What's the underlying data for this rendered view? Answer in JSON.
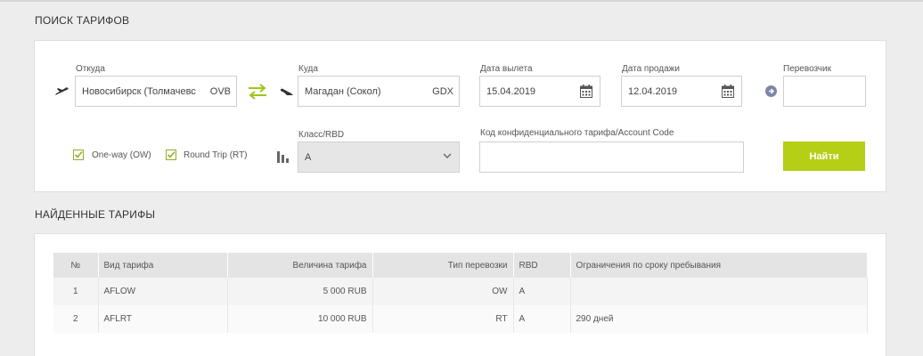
{
  "search": {
    "title": "ПОИСК ТАРИФОВ",
    "from_label": "Откуда",
    "from_value": "Новосибирск (Толмачевс",
    "from_code": "OVB",
    "to_label": "Куда",
    "to_value": "Магадан (Сокол)",
    "to_code": "GDX",
    "depart_label": "Дата вылета",
    "depart_value": "15.04.2019",
    "sale_label": "Дата продажи",
    "sale_value": "12.04.2019",
    "carrier_label": "Перевозчик",
    "carrier_value": "",
    "oneway_label": "One-way (OW)",
    "roundtrip_label": "Round Trip (RT)",
    "class_label": "Класс/RBD",
    "class_value": "A",
    "code_label": "Код конфиденциального тарифа/Account Code",
    "code_value": "",
    "find_button": "Найти"
  },
  "results": {
    "title": "НАЙДЕННЫЕ ТАРИФЫ",
    "headers": [
      "№",
      "Вид тарифа",
      "Величина тарифа",
      "Тип перевозки",
      "RBD",
      "Ограничения по сроку пребывания"
    ],
    "rows": [
      [
        "1",
        "AFLOW",
        "5 000  RUB",
        "OW",
        "A",
        ""
      ],
      [
        "2",
        "AFLRT",
        "10 000  RUB",
        "RT",
        "A",
        "290 дней"
      ]
    ]
  },
  "colors": {
    "accent": "#b5cf16",
    "swap_icon": "#9cc51d",
    "info_icon": "#7d86a8"
  },
  "icons": [
    "plane-departure-icon",
    "swap-arrows-icon",
    "plane-arrival-icon",
    "calendar-icon",
    "arrow-right-circle-icon",
    "class-bars-icon",
    "checkbox-checked-icon",
    "chevron-down-icon"
  ]
}
